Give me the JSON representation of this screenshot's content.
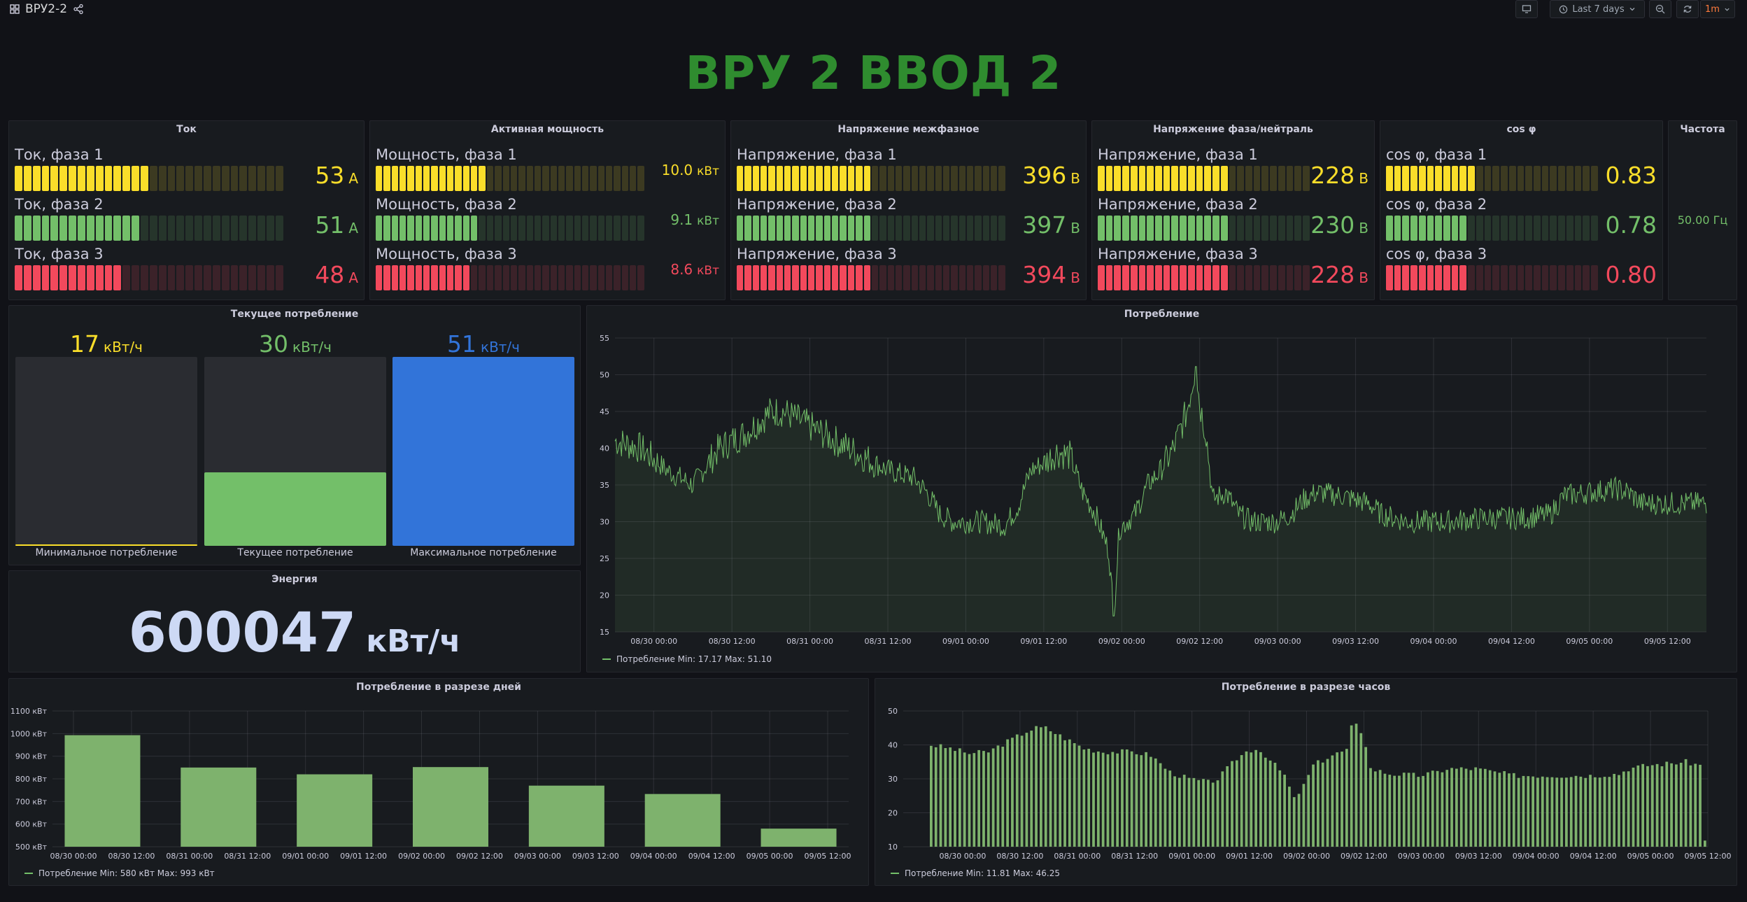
{
  "topbar": {
    "dashboard_title": "ВРУ2-2",
    "time_range": "Last 7 days",
    "refresh_interval": "1m"
  },
  "main_title": "ВРУ 2 ВВОД 2",
  "panels": {
    "current": {
      "title": "Ток",
      "rows": [
        {
          "label": "Ток, фаза 1",
          "value": "53",
          "unit": "А",
          "level": 0.5,
          "color": "#fade2a"
        },
        {
          "label": "Ток, фаза 2",
          "value": "51",
          "unit": "А",
          "level": 0.46,
          "color": "#73bf69"
        },
        {
          "label": "Ток, фаза 3",
          "value": "48",
          "unit": "А",
          "level": 0.39,
          "color": "#f2495c"
        }
      ]
    },
    "active_power": {
      "title": "Активная мощность",
      "rows": [
        {
          "label": "Мощность, фаза 1",
          "value": "10.0",
          "unit": "кВт",
          "level": 0.41,
          "color": "#fade2a"
        },
        {
          "label": "Мощность, фаза 2",
          "value": "9.1",
          "unit": "кВт",
          "level": 0.38,
          "color": "#73bf69"
        },
        {
          "label": "Мощность, фаза 3",
          "value": "8.6",
          "unit": "кВт",
          "level": 0.35,
          "color": "#f2495c"
        }
      ]
    },
    "line_voltage": {
      "title": "Напряжение межфазное",
      "rows": [
        {
          "label": "Напряжение, фаза 1",
          "value": "396",
          "unit": "В",
          "level": 0.5,
          "color": "#fade2a"
        },
        {
          "label": "Напряжение, фаза 2",
          "value": "397",
          "unit": "В",
          "level": 0.5,
          "color": "#73bf69"
        },
        {
          "label": "Напряжение, фаза 3",
          "value": "394",
          "unit": "В",
          "level": 0.5,
          "color": "#f2495c"
        }
      ]
    },
    "phase_voltage": {
      "title": "Напряжение фаза/нейтраль",
      "rows": [
        {
          "label": "Напряжение, фаза 1",
          "value": "228",
          "unit": "В",
          "level": 0.6,
          "color": "#fade2a"
        },
        {
          "label": "Напряжение, фаза 2",
          "value": "230",
          "unit": "В",
          "level": 0.6,
          "color": "#73bf69"
        },
        {
          "label": "Напряжение, фаза 3",
          "value": "228",
          "unit": "В",
          "level": 0.6,
          "color": "#f2495c"
        }
      ]
    },
    "cos_phi": {
      "title": "cos φ",
      "rows": [
        {
          "label": "cos φ, фаза 1",
          "value": "0.83",
          "unit": "",
          "level": 0.42,
          "color": "#fade2a"
        },
        {
          "label": "cos φ, фаза 2",
          "value": "0.78",
          "unit": "",
          "level": 0.38,
          "color": "#73bf69"
        },
        {
          "label": "cos φ, фаза 3",
          "value": "0.80",
          "unit": "",
          "level": 0.39,
          "color": "#f2495c"
        }
      ]
    },
    "frequency": {
      "title": "Частота",
      "value": "50.00 Гц"
    },
    "current_consumption": {
      "title": "Текущее потребление",
      "bars": [
        {
          "value": "17",
          "unit": "кВт/ч",
          "label": "Минимальное потребление",
          "level": 0.0,
          "color": "#fade2a"
        },
        {
          "value": "30",
          "unit": "кВт/ч",
          "label": "Текущее потребление",
          "level": 0.39,
          "color": "#73bf69"
        },
        {
          "value": "51",
          "unit": "кВт/ч",
          "label": "Максимальное потребление",
          "level": 1.0,
          "color": "#3274d9"
        }
      ]
    },
    "energy": {
      "title": "Энергия",
      "value": "600047",
      "unit": "кВт/ч"
    },
    "consumption": {
      "title": "Потребление",
      "legend": "Потребление  Min: 17.17  Max: 51.10"
    },
    "daily": {
      "title": "Потребление в разрезе дней",
      "legend": "Потребление  Min: 580 кВт  Max: 993 кВт"
    },
    "hourly": {
      "title": "Потребление в разрезе часов",
      "legend": "Потребление  Min: 11.81  Max: 46.25"
    }
  },
  "chart_data": [
    {
      "type": "line",
      "title": "Потребление",
      "series_name": "Потребление",
      "ylim": [
        15,
        55
      ],
      "y_ticks": [
        15,
        20,
        25,
        30,
        35,
        40,
        45,
        50,
        55
      ],
      "x_ticks": [
        "08/30 00:00",
        "08/30 12:00",
        "08/31 00:00",
        "08/31 12:00",
        "09/01 00:00",
        "09/01 12:00",
        "09/02 00:00",
        "09/02 12:00",
        "09/03 00:00",
        "09/03 12:00",
        "09/04 00:00",
        "09/04 12:00",
        "09/05 00:00",
        "09/05 12:00"
      ],
      "x_start": "08/29 18:00",
      "x_end": "09/05 18:00",
      "anchors": [
        [
          0,
          41
        ],
        [
          4,
          40
        ],
        [
          8,
          37
        ],
        [
          12,
          35
        ],
        [
          16,
          40
        ],
        [
          20,
          42
        ],
        [
          24,
          45
        ],
        [
          26,
          45
        ],
        [
          30,
          43
        ],
        [
          36,
          40
        ],
        [
          42,
          37
        ],
        [
          46,
          36
        ],
        [
          48,
          34
        ],
        [
          50,
          31
        ],
        [
          52,
          30
        ],
        [
          56,
          30
        ],
        [
          60,
          29.5
        ],
        [
          62,
          32
        ],
        [
          64,
          37
        ],
        [
          66,
          38
        ],
        [
          68,
          39.5
        ],
        [
          70,
          39
        ],
        [
          72,
          34
        ],
        [
          74,
          31
        ],
        [
          76,
          26
        ],
        [
          76.8,
          17.2
        ],
        [
          77.6,
          29
        ],
        [
          80,
          31
        ],
        [
          82,
          35
        ],
        [
          84,
          37
        ],
        [
          86,
          40
        ],
        [
          88,
          45
        ],
        [
          89.4,
          51.1
        ],
        [
          90,
          46
        ],
        [
          91,
          42
        ],
        [
          92,
          33
        ],
        [
          94,
          34
        ],
        [
          96,
          31
        ],
        [
          98,
          30
        ],
        [
          102,
          30
        ],
        [
          104,
          31
        ],
        [
          106,
          33
        ],
        [
          108,
          34
        ],
        [
          112,
          33.5
        ],
        [
          116,
          32.5
        ],
        [
          118,
          31
        ],
        [
          122,
          30
        ],
        [
          128,
          30
        ],
        [
          134,
          30.5
        ],
        [
          140,
          30.5
        ],
        [
          144,
          31
        ],
        [
          146,
          33.5
        ],
        [
          150,
          34
        ],
        [
          154,
          34.5
        ],
        [
          156,
          34
        ],
        [
          158,
          32.5
        ],
        [
          168,
          32.5
        ]
      ],
      "max": 51.1,
      "min": 17.17
    },
    {
      "type": "bar",
      "title": "Потребление в разрезе дней",
      "series_name": "Потребление",
      "y_unit": "кВт",
      "ylim": [
        500,
        1100
      ],
      "y_ticks": [
        500,
        600,
        700,
        800,
        900,
        1000,
        1100
      ],
      "x_ticks": [
        "08/30 00:00",
        "08/30 12:00",
        "08/31 00:00",
        "08/31 12:00",
        "09/01 00:00",
        "09/01 12:00",
        "09/02 00:00",
        "09/02 12:00",
        "09/03 00:00",
        "09/03 12:00",
        "09/04 00:00",
        "09/04 12:00",
        "09/05 00:00",
        "09/05 12:00"
      ],
      "categories": [
        "08/30",
        "08/31",
        "09/01",
        "09/02",
        "09/03",
        "09/04",
        "09/05"
      ],
      "values": [
        993,
        850,
        820,
        852,
        770,
        733,
        580
      ]
    },
    {
      "type": "bar",
      "title": "Потребление в разрезе часов",
      "series_name": "Потребление",
      "ylim": [
        10,
        50
      ],
      "y_ticks": [
        10,
        20,
        30,
        40,
        50
      ],
      "x_ticks": [
        "08/30 00:00",
        "08/30 12:00",
        "08/31 00:00",
        "08/31 12:00",
        "09/01 00:00",
        "09/01 12:00",
        "09/02 00:00",
        "09/02 12:00",
        "09/03 00:00",
        "09/03 12:00",
        "09/04 00:00",
        "09/04 12:00",
        "09/05 00:00",
        "09/05 12:00"
      ],
      "anchors": [
        [
          0,
          40
        ],
        [
          4,
          39
        ],
        [
          8,
          37.5
        ],
        [
          12,
          38
        ],
        [
          16,
          41
        ],
        [
          20,
          44
        ],
        [
          22,
          45
        ],
        [
          24,
          45
        ],
        [
          28,
          42
        ],
        [
          32,
          39
        ],
        [
          36,
          38
        ],
        [
          42,
          38
        ],
        [
          46,
          37
        ],
        [
          50,
          32
        ],
        [
          54,
          30
        ],
        [
          58,
          29
        ],
        [
          60,
          30
        ],
        [
          62,
          33
        ],
        [
          64,
          36
        ],
        [
          66,
          38
        ],
        [
          68,
          39
        ],
        [
          70,
          37
        ],
        [
          74,
          31
        ],
        [
          76,
          24
        ],
        [
          78,
          28
        ],
        [
          80,
          34
        ],
        [
          84,
          37
        ],
        [
          88,
          39
        ],
        [
          88.7,
          46.25
        ],
        [
          90,
          44
        ],
        [
          91,
          40
        ],
        [
          92,
          33
        ],
        [
          96,
          31.5
        ],
        [
          102,
          31
        ],
        [
          106,
          32
        ],
        [
          108,
          33
        ],
        [
          114,
          33
        ],
        [
          118,
          32
        ],
        [
          122,
          31
        ],
        [
          130,
          31
        ],
        [
          138,
          31
        ],
        [
          144,
          31.5
        ],
        [
          146,
          33
        ],
        [
          150,
          34
        ],
        [
          154,
          34.5
        ],
        [
          158,
          35
        ],
        [
          161,
          34
        ],
        [
          162,
          11.81
        ]
      ],
      "max": 46.25,
      "min": 11.81
    }
  ]
}
